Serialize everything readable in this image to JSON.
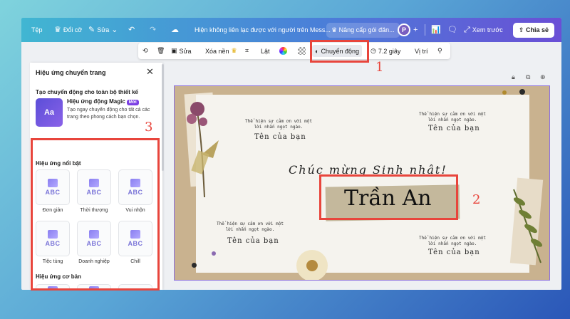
{
  "topbar": {
    "file": "Tệp",
    "resize": "Đổi cỡ",
    "edit": "Sửa",
    "status": "Hiện không liên lạc được với người trên Mess...",
    "upgrade": "Nâng cấp gói đăn...",
    "avatar": "P",
    "preview": "Xem trước",
    "share": "Chia sẻ"
  },
  "toolbar": {
    "edit": "Sửa",
    "remove_bg": "Xóa nền",
    "flip": "Lật",
    "animate": "Chuyển động",
    "duration": "7.2 giây",
    "position": "Vị trí"
  },
  "panel": {
    "title": "Hiệu ứng chuyển trang",
    "whole_design": "Tạo chuyển động cho toàn bộ thiết kế",
    "magic_name": "Hiệu ứng động Magic",
    "magic_badge": "Mới",
    "magic_desc": "Tạo ngay chuyển động cho tất cả các trang theo phong cách bạn chọn.",
    "magic_thumb": "Aa",
    "featured_label": "Hiệu ứng nổi bật",
    "featured": [
      {
        "label": "Đơn giản",
        "glyph": "ABC"
      },
      {
        "label": "Thời thượng",
        "glyph": "ABC"
      },
      {
        "label": "Vui nhộn",
        "glyph": "ABC"
      },
      {
        "label": "Tiệc tùng",
        "glyph": "ABC"
      },
      {
        "label": "Doanh nghiệp",
        "glyph": "ABC"
      },
      {
        "label": "Chill",
        "glyph": "ABC"
      }
    ],
    "basic_label": "Hiệu ứng cơ bản"
  },
  "card": {
    "msg": "Thể hiện sự cảm ơn với một lời nhắn ngọt ngào.",
    "small_name": "Tên của bạn",
    "greeting": "Chúc mừng Sinh nhật!",
    "name": "Trần An"
  },
  "annotations": {
    "n1": "1",
    "n2": "2",
    "n3": "3",
    "color": "#e8453c"
  }
}
